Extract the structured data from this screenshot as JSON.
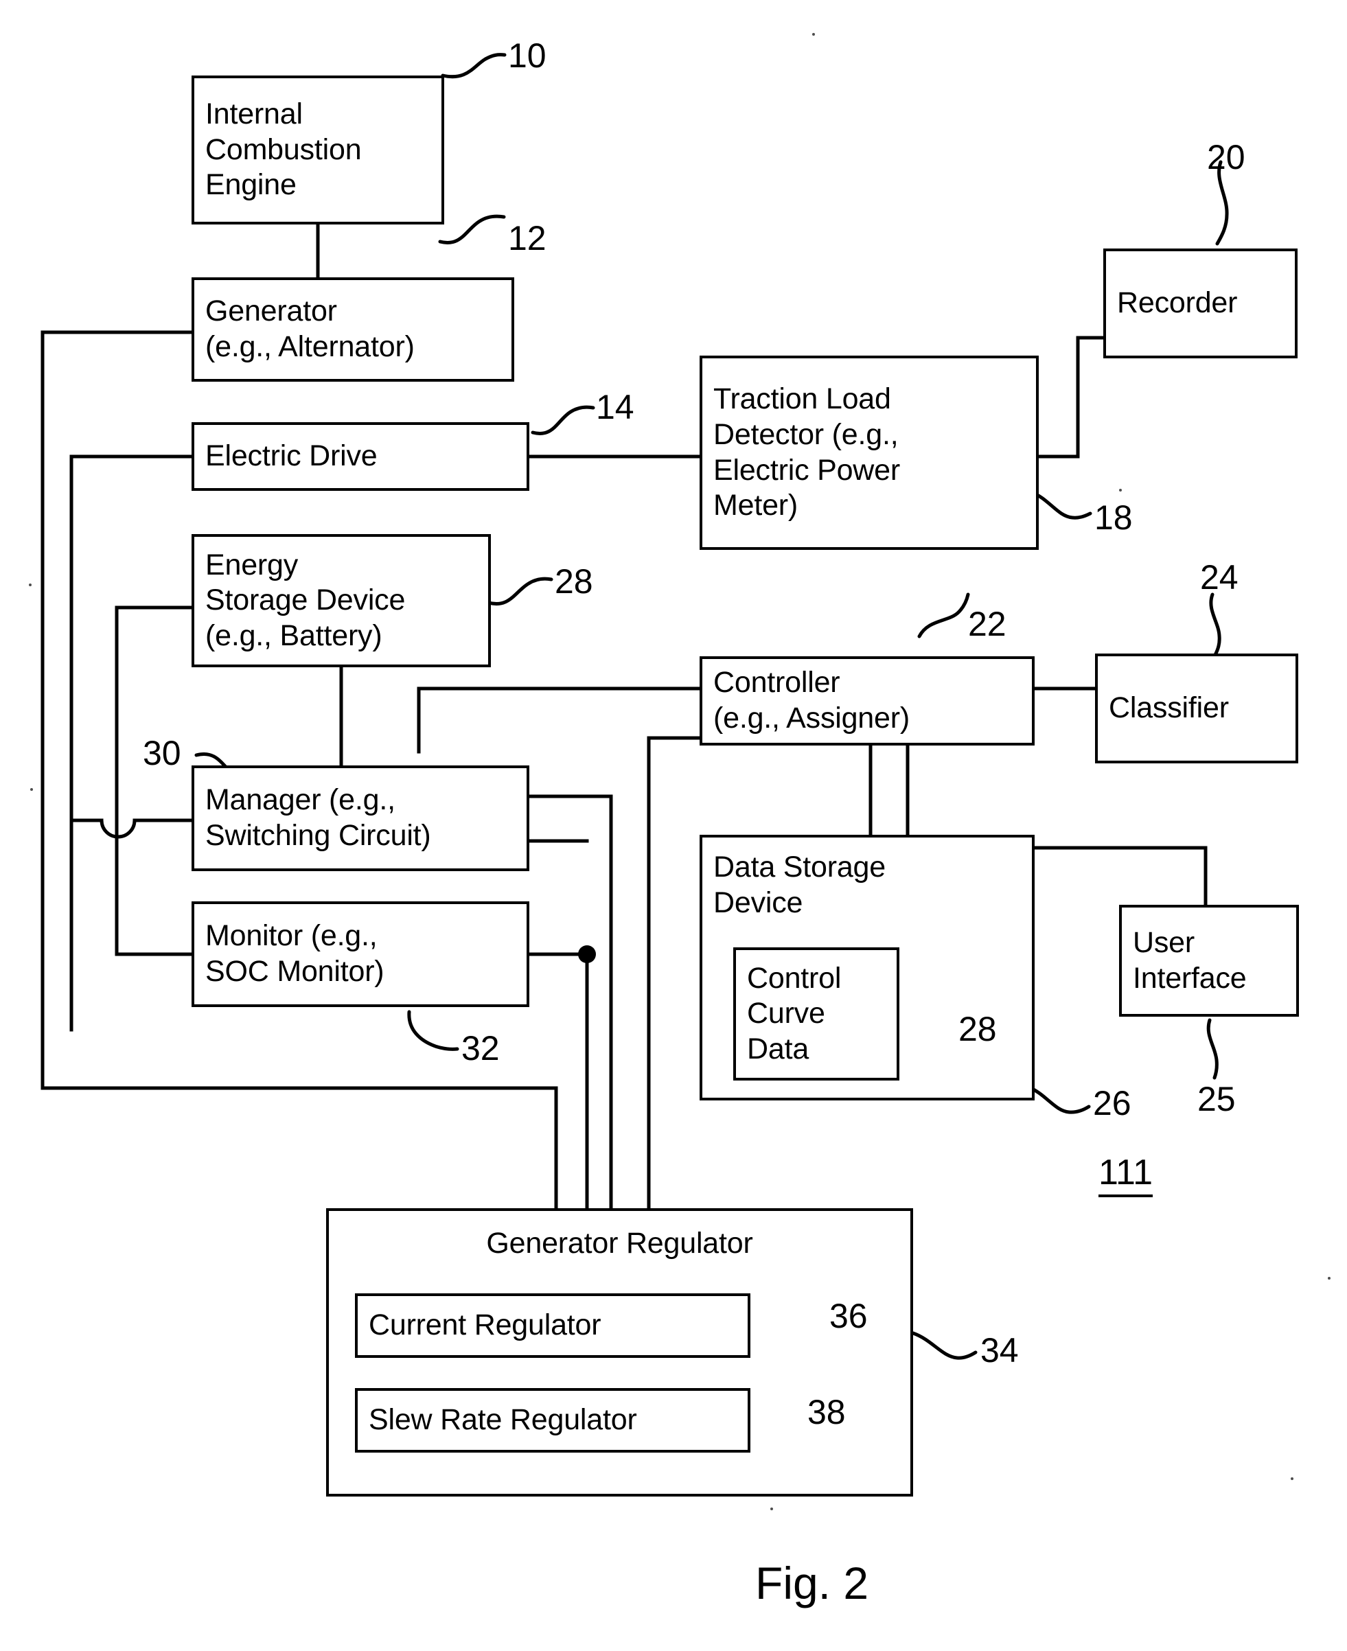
{
  "figure": {
    "caption": "Fig. 2",
    "system_number": "111"
  },
  "blocks": [
    {
      "id": "engine",
      "lines": [
        "Internal",
        "Combustion",
        "Engine"
      ],
      "ref": "10"
    },
    {
      "id": "generator",
      "lines": [
        "Generator",
        "(e.g., Alternator)"
      ],
      "ref": "12"
    },
    {
      "id": "electric_drive",
      "lines": [
        "Electric Drive"
      ],
      "ref": "14"
    },
    {
      "id": "traction_detector",
      "lines": [
        "Traction Load",
        "Detector (e.g.,",
        "Electric Power",
        "Meter)"
      ],
      "ref": "18"
    },
    {
      "id": "recorder",
      "lines": [
        "Recorder"
      ],
      "ref": "20"
    },
    {
      "id": "energy_storage",
      "lines": [
        "Energy",
        "Storage Device",
        "(e.g., Battery)"
      ],
      "ref": "28"
    },
    {
      "id": "manager",
      "lines": [
        "Manager (e.g.,",
        "Switching Circuit)"
      ],
      "ref": "30"
    },
    {
      "id": "monitor",
      "lines": [
        "Monitor (e.g.,",
        "SOC Monitor)"
      ],
      "ref": "32"
    },
    {
      "id": "controller",
      "lines": [
        "Controller",
        "(e.g., Assigner)"
      ],
      "ref": "22"
    },
    {
      "id": "classifier",
      "lines": [
        "Classifier"
      ],
      "ref": "24"
    },
    {
      "id": "data_storage",
      "lines": [
        "Data Storage",
        "Device"
      ],
      "ref": "26"
    },
    {
      "id": "control_curve",
      "lines": [
        "Control",
        "Curve",
        "Data"
      ],
      "ref": "28"
    },
    {
      "id": "user_interface",
      "lines": [
        "User",
        "Interface"
      ],
      "ref": "25"
    },
    {
      "id": "gen_regulator",
      "lines": [
        "Generator Regulator"
      ],
      "ref": "34"
    },
    {
      "id": "current_regulator",
      "lines": [
        "Current Regulator"
      ],
      "ref": "36"
    },
    {
      "id": "slew_regulator",
      "lines": [
        "Slew Rate Regulator"
      ],
      "ref": "38"
    }
  ],
  "text": {
    "engine_l1": "Internal",
    "engine_l2": "Combustion",
    "engine_l3": "Engine",
    "generator_l1": "Generator",
    "generator_l2": "(e.g., Alternator)",
    "electric_drive_l1": "Electric Drive",
    "traction_l1": "Traction Load",
    "traction_l2": "Detector (e.g.,",
    "traction_l3": "Electric Power",
    "traction_l4": "Meter)",
    "recorder_l1": "Recorder",
    "energy_l1": "Energy",
    "energy_l2": "Storage Device",
    "energy_l3": "(e.g., Battery)",
    "manager_l1": "Manager (e.g.,",
    "manager_l2": "Switching Circuit)",
    "monitor_l1": "Monitor (e.g.,",
    "monitor_l2": "SOC Monitor)",
    "controller_l1": "Controller",
    "controller_l2": "(e.g., Assigner)",
    "classifier_l1": "Classifier",
    "datastore_l1": "Data Storage",
    "datastore_l2": "Device",
    "curve_l1": "Control",
    "curve_l2": "Curve",
    "curve_l3": "Data",
    "ui_l1": "User",
    "ui_l2": "Interface",
    "genreg_l1": "Generator Regulator",
    "curreg_l1": "Current Regulator",
    "slewreg_l1": "Slew Rate Regulator"
  },
  "refs": {
    "r10": "10",
    "r12": "12",
    "r14": "14",
    "r18": "18",
    "r20": "20",
    "r22": "22",
    "r24": "24",
    "r25": "25",
    "r26": "26",
    "r28_energy": "28",
    "r28_curve": "28",
    "r30": "30",
    "r32": "32",
    "r34": "34",
    "r36": "36",
    "r38": "38"
  },
  "colors": {
    "ink": "#000000",
    "paper": "#ffffff"
  }
}
